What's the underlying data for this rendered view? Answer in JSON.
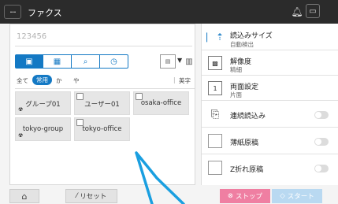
{
  "titlebar": {
    "menu_icon": "ellipsis-icon",
    "title": "ファクス",
    "bell_icon": "bell-icon",
    "tray_icon": "tray-icon"
  },
  "destination": {
    "value": "123456"
  },
  "tabs": [
    {
      "icon": "address-book-icon",
      "glyph": "▣",
      "active": true
    },
    {
      "icon": "grid-icon",
      "glyph": "▦",
      "active": false
    },
    {
      "icon": "search-icon",
      "glyph": "⌕",
      "active": false
    },
    {
      "icon": "history-icon",
      "glyph": "◷",
      "active": false
    }
  ],
  "view_select": {
    "label": "▤",
    "icon": "chevron-down-icon"
  },
  "index": {
    "all": "全て",
    "frequent": "常用",
    "ka": "か",
    "ya": "や",
    "sep": "|",
    "english": "英字"
  },
  "tiles": [
    {
      "label": "グループ01",
      "group": true,
      "checkbox": false
    },
    {
      "label": "ユーザー01",
      "group": false,
      "checkbox": true
    },
    {
      "label": "osaka-office",
      "group": false,
      "checkbox": true
    },
    {
      "label": "tokyo-group",
      "group": true,
      "checkbox": false
    },
    {
      "label": "tokyo-office",
      "group": false,
      "checkbox": true
    }
  ],
  "settings": {
    "scan_size": {
      "title": "読込みサイズ",
      "value": "自動検出"
    },
    "resolution": {
      "title": "解像度",
      "value": "精細"
    },
    "duplex": {
      "title": "両面設定",
      "value": "片面"
    },
    "continuous_scan": {
      "title": "連続読込み",
      "on": false
    },
    "thin_paper": {
      "title": "薄紙原稿",
      "on": false
    },
    "z_fold": {
      "title": "Z折れ原稿",
      "on": false
    }
  },
  "bottom": {
    "home_icon": "home-icon",
    "reset": "リセット",
    "stop": "ストップ",
    "start": "スタート"
  },
  "colors": {
    "accent": "#1479c4",
    "stop": "#ef7fa2",
    "start": "#b9d9f1",
    "pointer": "#1a9fe0"
  }
}
